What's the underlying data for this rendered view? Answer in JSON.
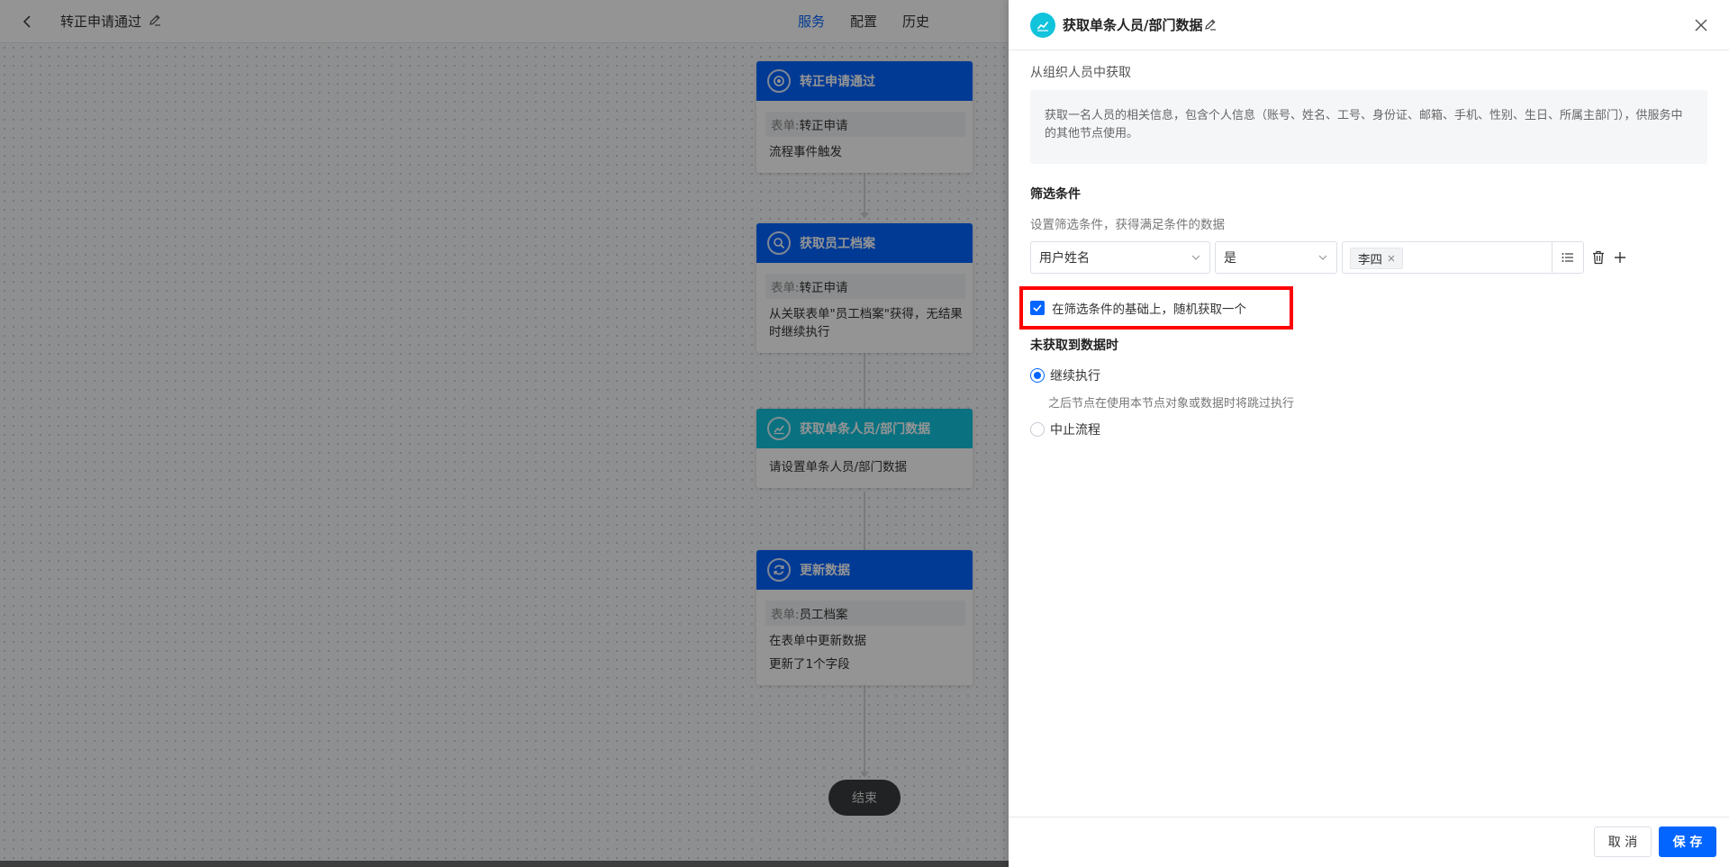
{
  "topbar": {
    "title": "转正申请通过",
    "tabs": [
      {
        "label": "服务",
        "active": true
      },
      {
        "label": "配置",
        "active": false
      },
      {
        "label": "历史",
        "active": false
      }
    ]
  },
  "workflow": {
    "nodes": [
      {
        "title": "转正申请通过",
        "icon": "target-icon",
        "form_label": "表单:",
        "form_value": "转正申请",
        "lines": [
          "流程事件触发"
        ]
      },
      {
        "title": "获取员工档案",
        "icon": "search-icon",
        "form_label": "表单:",
        "form_value": "转正申请",
        "lines": [
          "从关联表单\"员工档案\"获得，无结果时继续执行"
        ]
      },
      {
        "title": "获取单条人员/部门数据",
        "icon": "chart-line-icon",
        "lines": [
          "请设置单条人员/部门数据"
        ]
      },
      {
        "title": "更新数据",
        "icon": "refresh-icon",
        "form_label": "表单:",
        "form_value": "员工档案",
        "lines": [
          "在表单中更新数据",
          "更新了1个字段"
        ]
      }
    ],
    "end_label": "结束"
  },
  "drawer": {
    "title": "获取单条人员/部门数据",
    "source_label": "从组织人员中获取",
    "description": "获取一名人员的相关信息，包含个人信息（账号、姓名、工号、身份证、邮箱、手机、性别、生日、所属主部门），供服务中的其他节点使用。",
    "filter": {
      "title": "筛选条件",
      "description": "设置筛选条件，获得满足条件的数据",
      "field": "用户姓名",
      "operator": "是",
      "value_tag": "李四"
    },
    "random_pick": {
      "label": "在筛选条件的基础上，随机获取一个",
      "checked": true
    },
    "no_data": {
      "title": "未获取到数据时",
      "options": [
        {
          "label": "继续执行",
          "selected": true,
          "hint": "之后节点在使用本节点对象或数据时将跳过执行"
        },
        {
          "label": "中止流程",
          "selected": false
        }
      ]
    },
    "footer": {
      "cancel_label": "取 消",
      "save_label": "保 存"
    }
  },
  "colors": {
    "primary": "#0265ff",
    "cyan": "#12c3dc",
    "highlight": "#ff0000"
  }
}
